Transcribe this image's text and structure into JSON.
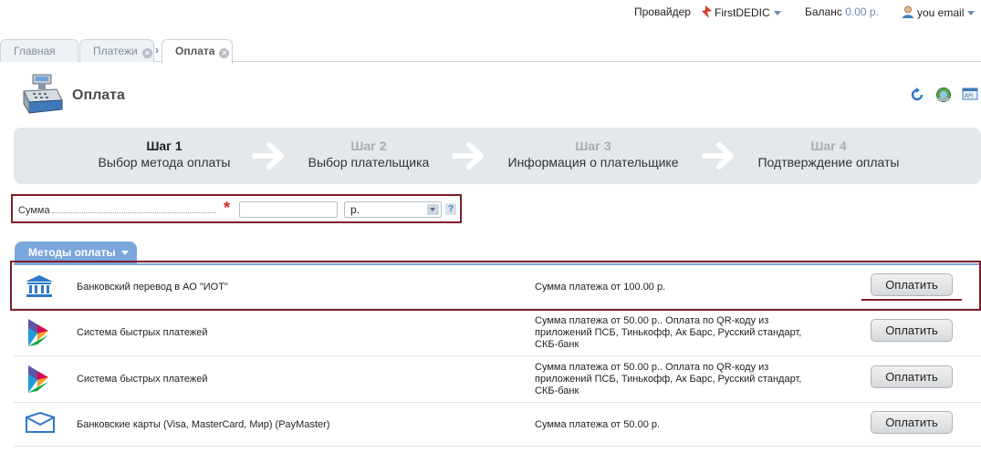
{
  "header": {
    "provider_label": "Провайдер",
    "provider_name": "FirstDEDIC",
    "balance_label": "Баланс",
    "balance_value": "0.00 р.",
    "user_label": "you email"
  },
  "tabs": [
    {
      "label": "Главная"
    },
    {
      "label": "Платежи"
    },
    {
      "label": "Оплата"
    }
  ],
  "page": {
    "title": "Оплата"
  },
  "steps": [
    {
      "step": "Шаг 1",
      "label": "Выбор метода оплаты"
    },
    {
      "step": "Шаг 2",
      "label": "Выбор плательщика"
    },
    {
      "step": "Шаг 3",
      "label": "Информация о плательщике"
    },
    {
      "step": "Шаг 4",
      "label": "Подтверждение оплаты"
    }
  ],
  "form": {
    "sum_label": "Сумма",
    "sum_value": "",
    "currency": "р.",
    "help": "?"
  },
  "methods": {
    "tab_label": "Методы оплаты",
    "pay_label": "Оплатить",
    "items": [
      {
        "name": "Банковский перевод в АО \"ИОТ\"",
        "desc": "Сумма платежа от 100.00 р."
      },
      {
        "name": "Система быстрых платежей",
        "desc": "Сумма платежа от 50.00 р.. Оплата по QR-коду из приложений ПСБ, Тинькофф, Ак Барс, Русский стандарт, СКБ-банк"
      },
      {
        "name": "Система быстрых платежей",
        "desc": "Сумма платежа от 50.00 р.. Оплата по QR-коду из приложений ПСБ, Тинькофф, Ак Барс, Русский стандарт, СКБ-банк"
      },
      {
        "name": "Банковские карты (Visa, MasterCard, Мир) (PayMaster)",
        "desc": "Сумма платежа от 50.00 р."
      }
    ]
  },
  "colors": {
    "accent": "#7ba6dc",
    "highlight": "#7e1f2a",
    "steps_bg": "#e3e8ec"
  }
}
